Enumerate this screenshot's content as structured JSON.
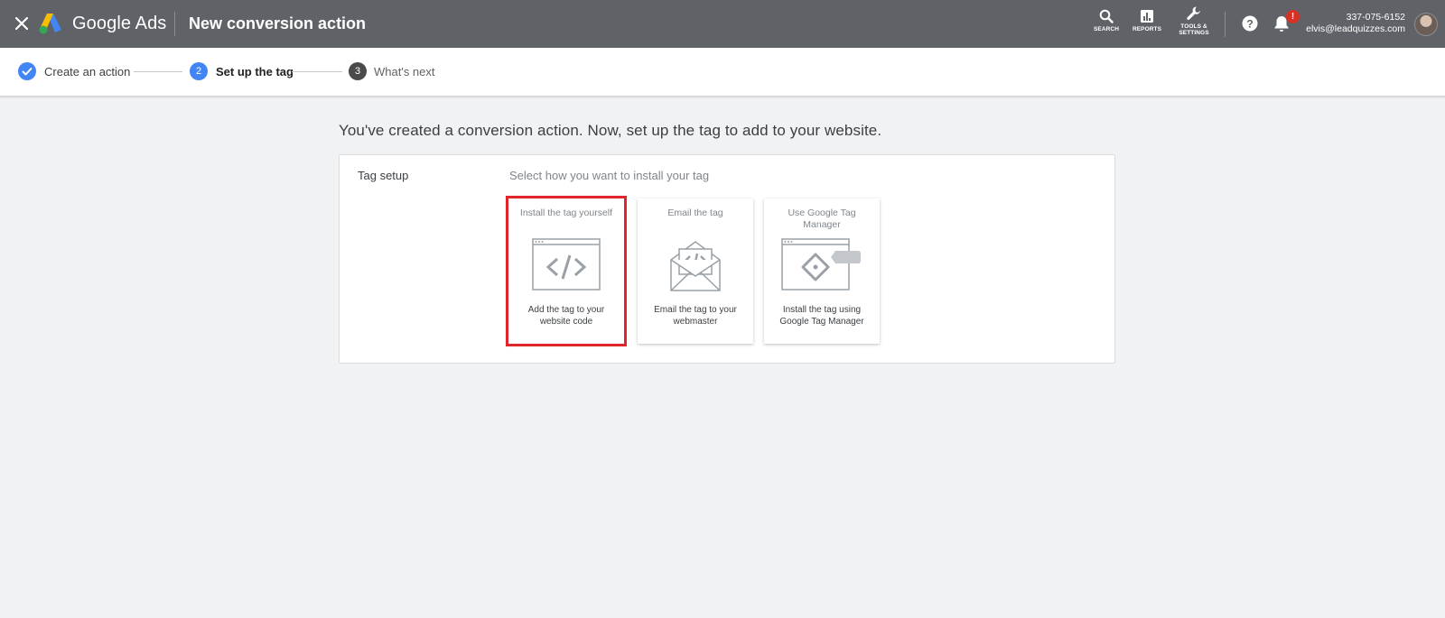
{
  "header": {
    "brand": "Google Ads",
    "title": "New conversion action",
    "tools": [
      {
        "label": "SEARCH",
        "icon": "search-icon"
      },
      {
        "label": "REPORTS",
        "icon": "reports-icon"
      },
      {
        "label_line1": "TOOLS &",
        "label_line2": "SETTINGS",
        "icon": "wrench-icon"
      }
    ],
    "notification_badge": "!",
    "account_id": "337-075-6152",
    "account_email": "elvis@leadquizzes.com"
  },
  "stepper": {
    "steps": [
      {
        "number": "✓",
        "label": "Create an action",
        "state": "complete"
      },
      {
        "number": "2",
        "label": "Set up the tag",
        "state": "active"
      },
      {
        "number": "3",
        "label": "What's next",
        "state": "upcoming"
      }
    ]
  },
  "main": {
    "headline": "You've created a conversion action. Now, set up the tag to add to your website.",
    "section_label": "Tag setup",
    "section_hint": "Select how you want to install your tag",
    "options": [
      {
        "title": "Install the tag yourself",
        "desc_line1": "Add the tag to your",
        "desc_line2": "website code",
        "icon": "code-window-icon",
        "selected": true
      },
      {
        "title": "Email the tag",
        "desc_line1": "Email the tag to your",
        "desc_line2": "webmaster",
        "icon": "email-code-icon",
        "selected": false
      },
      {
        "title_line1": "Use Google Tag",
        "title_line2": "Manager",
        "desc_line1": "Install the tag using",
        "desc_line2": "Google Tag Manager",
        "icon": "tag-manager-icon",
        "selected": false
      }
    ]
  },
  "colors": {
    "topbar": "#5f6368",
    "accent_blue": "#4285f4",
    "step_inactive": "#5f6368",
    "selection_outline": "#e0252b",
    "background": "#f1f2f4"
  }
}
